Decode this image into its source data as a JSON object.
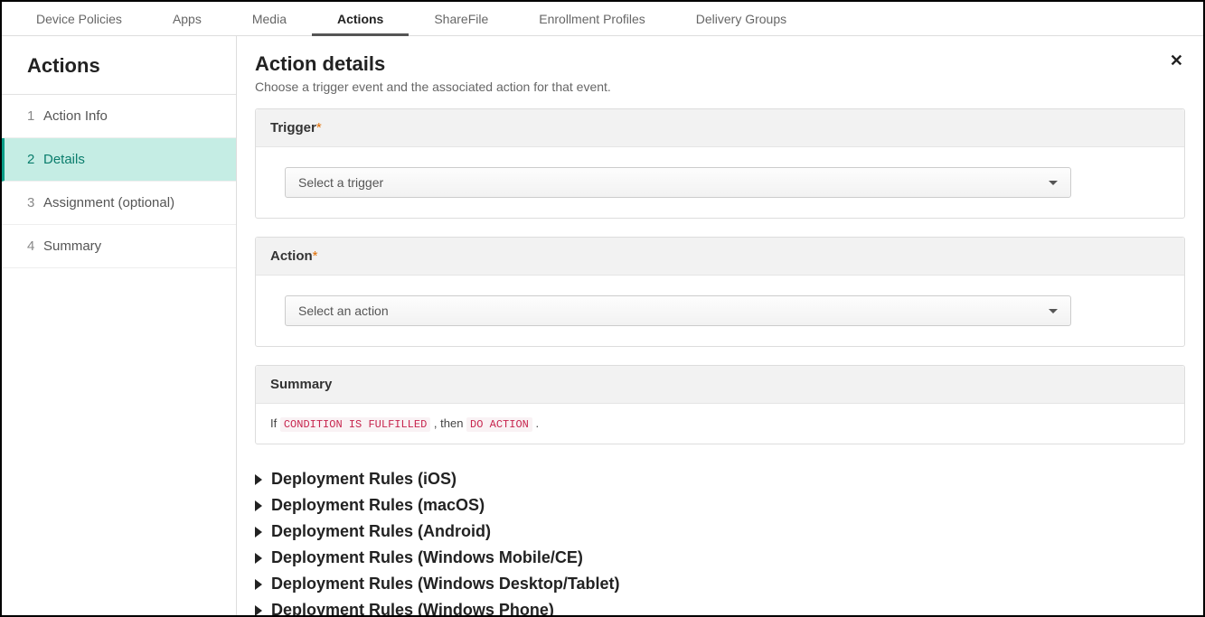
{
  "topTabs": {
    "t0": "Device Policies",
    "t1": "Apps",
    "t2": "Media",
    "t3": "Actions",
    "t4": "ShareFile",
    "t5": "Enrollment Profiles",
    "t6": "Delivery Groups"
  },
  "sidebar": {
    "title": "Actions",
    "steps": {
      "s1": {
        "num": "1",
        "label": "Action Info"
      },
      "s2": {
        "num": "2",
        "label": "Details"
      },
      "s3": {
        "num": "3",
        "label": "Assignment (optional)"
      },
      "s4": {
        "num": "4",
        "label": "Summary"
      }
    }
  },
  "page": {
    "title": "Action details",
    "subtitle": "Choose a trigger event and the associated action for that event.",
    "close": "✕"
  },
  "panels": {
    "trigger": {
      "title": "Trigger",
      "dropdown": "Select a trigger"
    },
    "action": {
      "title": "Action",
      "dropdown": "Select an action"
    },
    "summary": {
      "title": "Summary",
      "text_if": "If ",
      "token_condition": "CONDITION IS FULFILLED",
      "text_then": " , then ",
      "token_action": "DO ACTION",
      "text_end": " ."
    }
  },
  "rules": {
    "r0": "Deployment Rules (iOS)",
    "r1": "Deployment Rules (macOS)",
    "r2": "Deployment Rules (Android)",
    "r3": "Deployment Rules (Windows Mobile/CE)",
    "r4": "Deployment Rules (Windows Desktop/Tablet)",
    "r5": "Deployment Rules (Windows Phone)"
  }
}
